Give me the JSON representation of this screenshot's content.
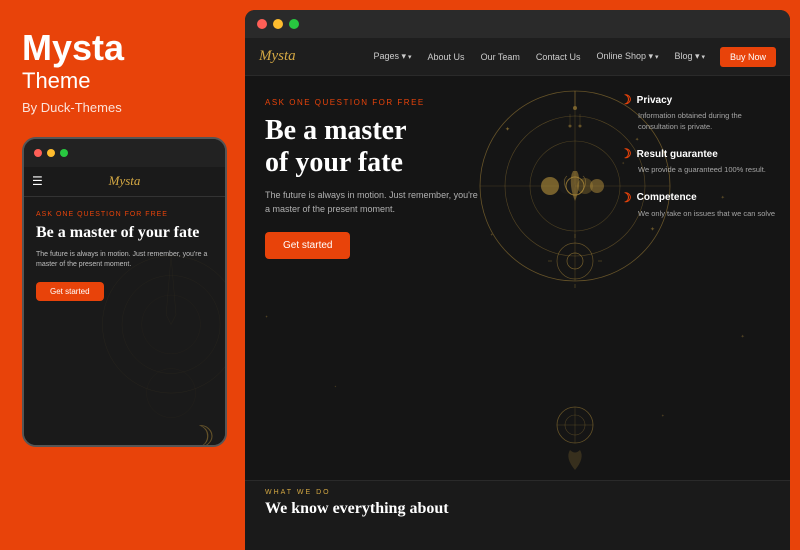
{
  "left": {
    "brand_title": "Mysta",
    "brand_subtitle": "Theme",
    "brand_by": "By Duck-Themes",
    "mobile": {
      "dots": [
        {
          "color": "#ff5f57"
        },
        {
          "color": "#febc2e"
        },
        {
          "color": "#28c840"
        }
      ],
      "logo": "Mysta",
      "ask_label": "ASK ONE QUESTION FOR FREE",
      "heading": "Be a master of your fate",
      "desc": "The future is always in motion. Just remember, you're a master of the present moment.",
      "cta": "Get started"
    }
  },
  "right": {
    "dots": [
      {
        "color": "#ff5f57"
      },
      {
        "color": "#febc2e"
      },
      {
        "color": "#28c840"
      }
    ],
    "nav": {
      "logo": "Mysta",
      "items": [
        {
          "label": "Pages",
          "dropdown": true
        },
        {
          "label": "About Us",
          "dropdown": false
        },
        {
          "label": "Our Team",
          "dropdown": false
        },
        {
          "label": "Contact Us",
          "dropdown": false
        },
        {
          "label": "Online Shop",
          "dropdown": true
        },
        {
          "label": "Blog",
          "dropdown": true
        }
      ],
      "buy_btn": "Buy Now"
    },
    "hero": {
      "ask_label": "ASK ONE QUESTION FOR FREE",
      "heading_line1": "Be a master",
      "heading_line2": "of your fate",
      "desc": "The future is always in motion. Just remember, you're a master of the present moment.",
      "cta": "Get started"
    },
    "features": [
      {
        "title": "Privacy",
        "desc": "Information obtained during the consultation is private."
      },
      {
        "title": "Result guarantee",
        "desc": "We provide a guaranteed 100% result."
      },
      {
        "title": "Competence",
        "desc": "We only take on issues that we can solve"
      }
    ],
    "bottom": {
      "what_label": "WHAT WE DO",
      "what_heading": "We know everything about"
    }
  }
}
